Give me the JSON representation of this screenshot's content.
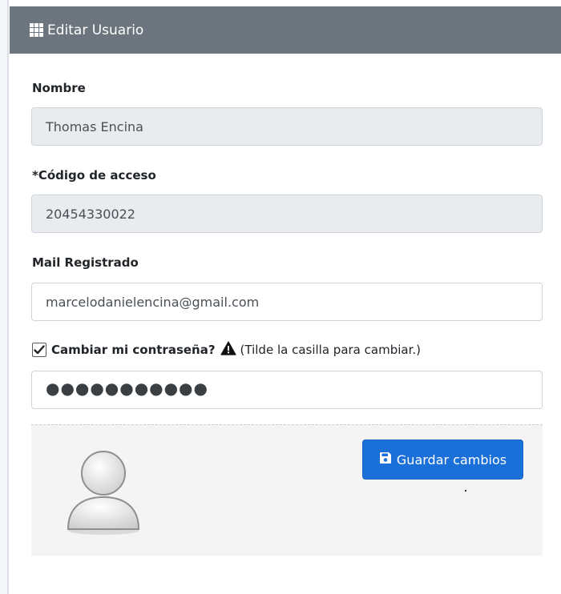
{
  "card": {
    "title": "Editar Usuario",
    "title_icon": "th-grid-icon"
  },
  "form": {
    "nombre": {
      "label": "Nombre",
      "value": "Thomas Encina"
    },
    "codigo": {
      "label": "*Código de acceso",
      "value": "20454330022"
    },
    "mail": {
      "label": "Mail Registrado",
      "value": "marcelodanielencina@gmail.com"
    },
    "change_password": {
      "checked": true,
      "label": "Cambiar mi contraseña?",
      "hint": "(Tilde la casilla para cambiar.)",
      "icon": "warning-icon"
    },
    "password": {
      "value": "●●●●●●●●●●●"
    }
  },
  "footer": {
    "avatar": "user-avatar",
    "save_label": "Guardar cambios",
    "save_icon": "floppy-disk-icon"
  },
  "colors": {
    "header_bg": "#6c757d",
    "primary": "#1a6fd8",
    "readonly_bg": "#e9ecef",
    "footer_bg": "#f4f4f4"
  }
}
